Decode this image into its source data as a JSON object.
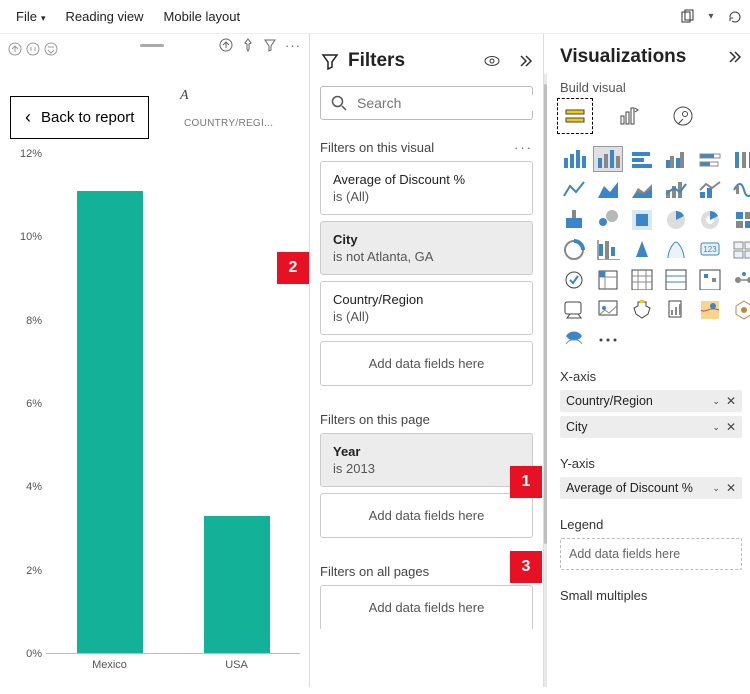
{
  "top_menu": {
    "file": "File",
    "reading_view": "Reading view",
    "mobile_layout": "Mobile layout"
  },
  "chart": {
    "back_label": "Back to report",
    "legend_truncated": "COUNTRY/REGI...",
    "categories": [
      "Mexico",
      "USA"
    ]
  },
  "chart_data": {
    "type": "bar",
    "title": "",
    "xlabel": "",
    "ylabel": "",
    "categories": [
      "Mexico",
      "USA"
    ],
    "values": [
      11.1,
      3.3
    ],
    "ylim": [
      0,
      12
    ],
    "y_ticks": [
      0,
      2,
      4,
      6,
      8,
      10,
      12
    ],
    "y_tick_labels": [
      "0%",
      "2%",
      "4%",
      "6%",
      "8%",
      "10%",
      "12%"
    ],
    "color": "#13b298"
  },
  "filters": {
    "title": "Filters",
    "search_placeholder": "Search",
    "sections": {
      "visual": {
        "label": "Filters on this visual",
        "cards": [
          {
            "name": "Average of Discount %",
            "cond": "is (All)"
          },
          {
            "name": "City",
            "cond": "is not Atlanta, GA"
          },
          {
            "name": "Country/Region",
            "cond": "is (All)"
          }
        ],
        "drop": "Add data fields here"
      },
      "page": {
        "label": "Filters on this page",
        "cards": [
          {
            "name": "Year",
            "cond": "is 2013"
          }
        ],
        "drop": "Add data fields here"
      },
      "all": {
        "label": "Filters on all pages",
        "drop": "Add data fields here"
      }
    }
  },
  "viz": {
    "title": "Visualizations",
    "build_label": "Build visual",
    "sections": {
      "x_axis": {
        "label": "X-axis",
        "fields": [
          "Country/Region",
          "City"
        ]
      },
      "y_axis": {
        "label": "Y-axis",
        "fields": [
          "Average of Discount %"
        ]
      },
      "legend": {
        "label": "Legend",
        "drop": "Add data fields here"
      },
      "small_multiples": {
        "label": "Small multiples"
      }
    }
  },
  "callouts": {
    "c1": "1",
    "c2": "2",
    "c3": "3"
  }
}
